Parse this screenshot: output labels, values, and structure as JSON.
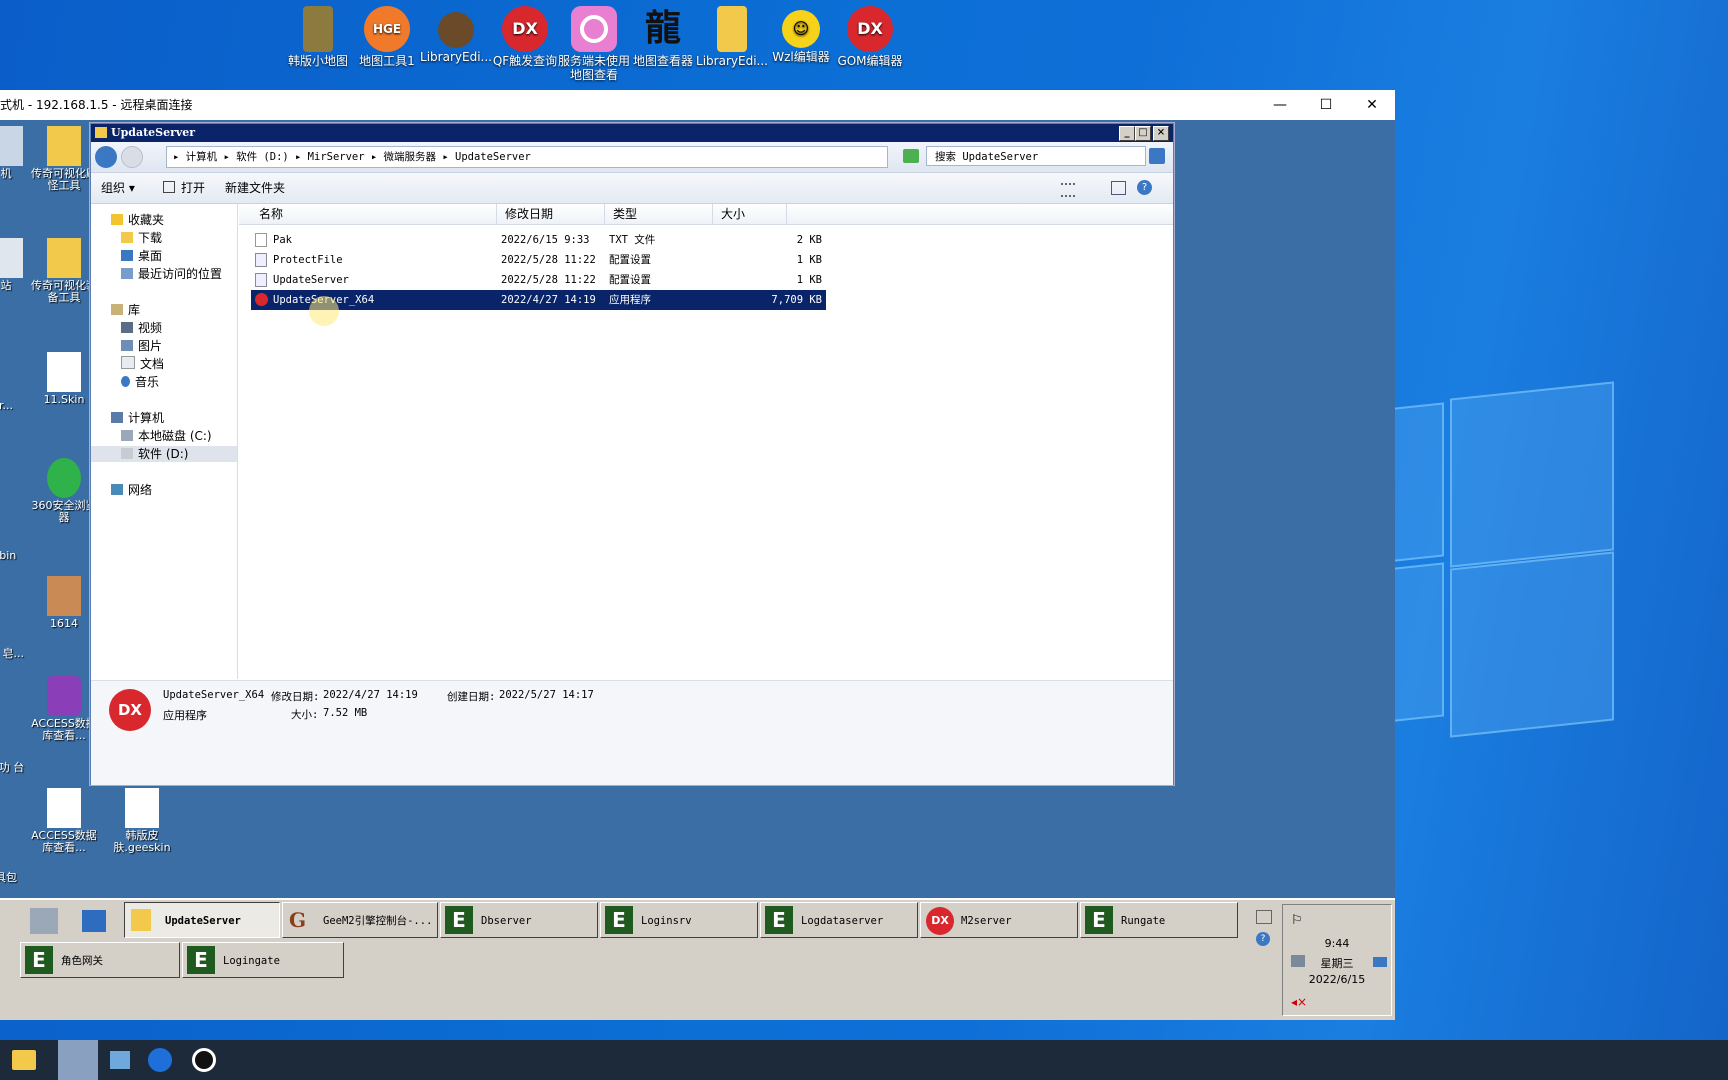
{
  "host_desktop_icons": [
    {
      "label": "韩版小地图",
      "icon": "folder-map-icon"
    },
    {
      "label": "地图工具1",
      "icon": "hge-icon",
      "badge": "HGE"
    },
    {
      "label": "LibraryEdi...",
      "icon": "library-editor-icon"
    },
    {
      "label": "QF触发查询",
      "icon": "dx-icon",
      "badge": "DX"
    },
    {
      "label": "服务端未使用地图查看",
      "icon": "ring-icon"
    },
    {
      "label": "地图查看器",
      "icon": "dragon-icon",
      "badge": "龍"
    },
    {
      "label": "LibraryEdi...",
      "icon": "folder-icon"
    },
    {
      "label": "Wzl编辑器",
      "icon": "smiley-icon"
    },
    {
      "label": "GOM编辑器",
      "icon": "dx-icon",
      "badge": "DX"
    }
  ],
  "rdp": {
    "title": "式机 - 192.168.1.5 - 远程桌面连接",
    "minimize": "—",
    "maximize": "☐",
    "close": "✕"
  },
  "remote_desktop_icons": [
    {
      "label": "机"
    },
    {
      "label": "传奇可视化刷怪工具"
    },
    {
      "label": "站"
    },
    {
      "label": "传奇可视化装备工具"
    },
    {
      "label": "r..."
    },
    {
      "label": "11.Skin"
    },
    {
      "label": ".bin"
    },
    {
      "label": "360安全浏览器"
    },
    {
      "label": "件 皂..."
    },
    {
      "label": "1614"
    },
    {
      "label": "多功 台"
    },
    {
      "label": "ACCESS数据库查看..."
    },
    {
      "label": "具包"
    },
    {
      "label": "ACCESS数据库查看..."
    },
    {
      "label": "韩版皮肤.geeskin"
    }
  ],
  "explorer": {
    "title": "UpdateServer",
    "breadcrumb": "▸ 计算机 ▸ 软件 (D:) ▸ MirServer ▸ 微端服务器 ▸ UpdateServer",
    "search_placeholder": "搜索 UpdateServer",
    "toolbar": {
      "organize": "组织 ▾",
      "open": "打开",
      "new_folder": "新建文件夹"
    },
    "nav": {
      "favorites": "收藏夹",
      "downloads": "下载",
      "desktop": "桌面",
      "recent": "最近访问的位置",
      "libraries": "库",
      "videos": "视频",
      "pictures": "图片",
      "documents": "文档",
      "music": "音乐",
      "computer": "计算机",
      "drive_c": "本地磁盘 (C:)",
      "drive_d": "软件 (D:)",
      "network": "网络"
    },
    "columns": {
      "name": "名称",
      "modified": "修改日期",
      "type": "类型",
      "size": "大小"
    },
    "files": [
      {
        "name": "Pak",
        "modified": "2022/6/15 9:33",
        "type": "TXT 文件",
        "size": "2 KB"
      },
      {
        "name": "ProtectFile",
        "modified": "2022/5/28 11:22",
        "type": "配置设置",
        "size": "1 KB"
      },
      {
        "name": "UpdateServer",
        "modified": "2022/5/28 11:22",
        "type": "配置设置",
        "size": "1 KB"
      },
      {
        "name": "UpdateServer_X64",
        "modified": "2022/4/27 14:19",
        "type": "应用程序",
        "size": "7,709 KB"
      }
    ],
    "details": {
      "name": "UpdateServer_X64",
      "modified_label": "修改日期:",
      "modified": "2022/4/27 14:19",
      "created_label": "创建日期:",
      "created": "2022/5/27 14:17",
      "type": "应用程序",
      "size_label": "大小:",
      "size": "7.52 MB"
    }
  },
  "remote_taskbar": {
    "row1": [
      "UpdateServer",
      "GeeM2引擎控制台-...",
      "Dbserver",
      "Loginsrv",
      "Logdataserver",
      "M2server",
      "Rungate"
    ],
    "row2": [
      "角色网关",
      "Logingate"
    ],
    "clock": {
      "time": "9:44",
      "day": "星期三",
      "date": "2022/6/15"
    }
  }
}
